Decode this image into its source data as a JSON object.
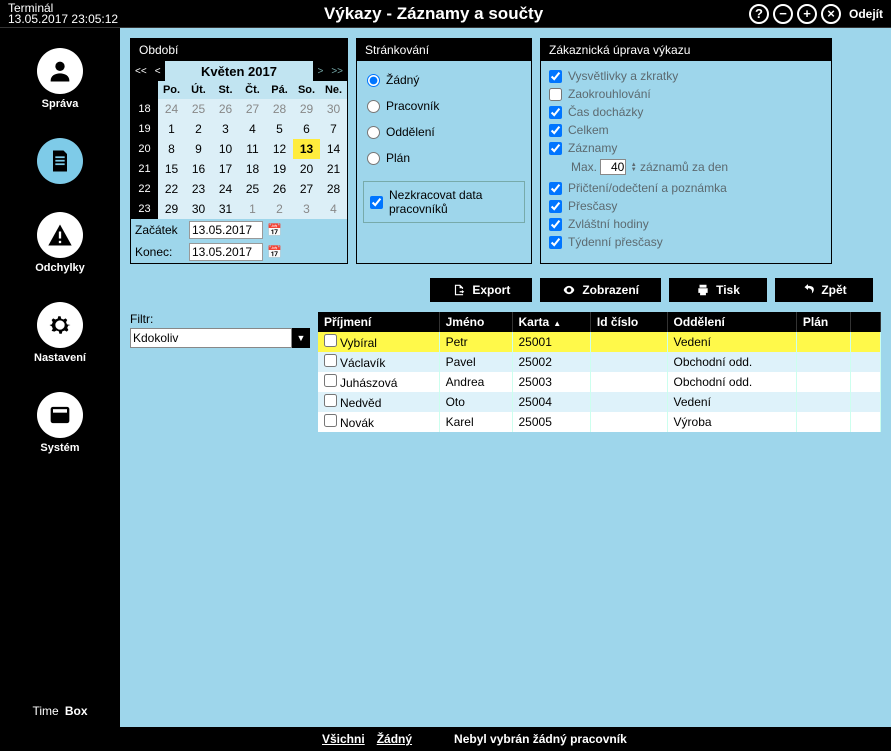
{
  "title": {
    "term": "Terminál",
    "datetime": "13.05.2017 23:05:12",
    "page": "Výkazy - Záznamy a součty",
    "exit": "Odejít"
  },
  "nav": {
    "sprava": "Správa",
    "doc": "",
    "odchylky": "Odchylky",
    "nastaveni": "Nastavení",
    "system": "Systém"
  },
  "brand": {
    "time": "Time",
    "box": "Box"
  },
  "panel": {
    "obdobi": "Období",
    "strank": "Stránkování",
    "zak": "Zákaznická úprava výkazu"
  },
  "calendar": {
    "month": "Květen 2017",
    "dow": [
      "Po.",
      "Út.",
      "St.",
      "Čt.",
      "Pá.",
      "So.",
      "Ne."
    ],
    "weeks": [
      {
        "wk": "18",
        "days": [
          {
            "d": "24",
            "o": true
          },
          {
            "d": "25",
            "o": true
          },
          {
            "d": "26",
            "o": true
          },
          {
            "d": "27",
            "o": true
          },
          {
            "d": "28",
            "o": true
          },
          {
            "d": "29",
            "o": true
          },
          {
            "d": "30",
            "o": true
          }
        ]
      },
      {
        "wk": "19",
        "days": [
          {
            "d": "1"
          },
          {
            "d": "2"
          },
          {
            "d": "3"
          },
          {
            "d": "4"
          },
          {
            "d": "5"
          },
          {
            "d": "6"
          },
          {
            "d": "7"
          }
        ]
      },
      {
        "wk": "20",
        "days": [
          {
            "d": "8"
          },
          {
            "d": "9"
          },
          {
            "d": "10"
          },
          {
            "d": "11"
          },
          {
            "d": "12"
          },
          {
            "d": "13",
            "t": true
          },
          {
            "d": "14"
          }
        ]
      },
      {
        "wk": "21",
        "days": [
          {
            "d": "15"
          },
          {
            "d": "16"
          },
          {
            "d": "17"
          },
          {
            "d": "18"
          },
          {
            "d": "19"
          },
          {
            "d": "20"
          },
          {
            "d": "21"
          }
        ]
      },
      {
        "wk": "22",
        "days": [
          {
            "d": "22"
          },
          {
            "d": "23"
          },
          {
            "d": "24"
          },
          {
            "d": "25"
          },
          {
            "d": "26"
          },
          {
            "d": "27"
          },
          {
            "d": "28"
          }
        ]
      },
      {
        "wk": "23",
        "days": [
          {
            "d": "29"
          },
          {
            "d": "30"
          },
          {
            "d": "31"
          },
          {
            "d": "1",
            "o": true
          },
          {
            "d": "2",
            "o": true
          },
          {
            "d": "3",
            "o": true
          },
          {
            "d": "4",
            "o": true
          }
        ]
      }
    ],
    "start_lbl": "Začátek",
    "end_lbl": "Konec:",
    "start": "13.05.2017",
    "end": "13.05.2017"
  },
  "paging": {
    "zadny": "Žádný",
    "pracovnik": "Pracovník",
    "oddeleni": "Oddělení",
    "plan": "Plán",
    "nezkr": "Nezkracovat data pracovníků"
  },
  "custom": {
    "vysvet": "Vysvětlivky a zkratky",
    "zaok": "Zaokrouhlování",
    "cas": "Čas docházky",
    "celkem": "Celkem",
    "zazn": "Záznamy",
    "max_lbl": "Max.",
    "max_val": "40",
    "max_suffix": "záznamů za den",
    "prict": "Přičtení/odečtení a poznámka",
    "presc": "Přesčasy",
    "zvl": "Zvláštní hodiny",
    "tyd": "Týdenní přesčasy"
  },
  "actions": {
    "export": "Export",
    "zobraz": "Zobrazení",
    "tisk": "Tisk",
    "zpet": "Zpět"
  },
  "filter": {
    "lbl": "Filtr:",
    "val": "Kdokoliv"
  },
  "grid": {
    "cols": {
      "prijmeni": "Příjmení",
      "jmeno": "Jméno",
      "karta": "Karta",
      "id": "Id číslo",
      "odd": "Oddělení",
      "plan": "Plán"
    },
    "rows": [
      {
        "prijmeni": "Vybíral",
        "jmeno": "Petr",
        "karta": "25001",
        "id": "",
        "odd": "Vedení",
        "plan": "",
        "sel": true
      },
      {
        "prijmeni": "Václavík",
        "jmeno": "Pavel",
        "karta": "25002",
        "id": "",
        "odd": "Obchodní odd.",
        "plan": ""
      },
      {
        "prijmeni": "Juhászová",
        "jmeno": "Andrea",
        "karta": "25003",
        "id": "",
        "odd": "Obchodní odd.",
        "plan": ""
      },
      {
        "prijmeni": "Nedvěd",
        "jmeno": "Oto",
        "karta": "25004",
        "id": "",
        "odd": "Vedení",
        "plan": ""
      },
      {
        "prijmeni": "Novák",
        "jmeno": "Karel",
        "karta": "25005",
        "id": "",
        "odd": "Výroba",
        "plan": ""
      }
    ]
  },
  "status": {
    "vsichni": "Všichni",
    "zadny": "Žádný",
    "msg": "Nebyl vybrán žádný pracovník"
  }
}
